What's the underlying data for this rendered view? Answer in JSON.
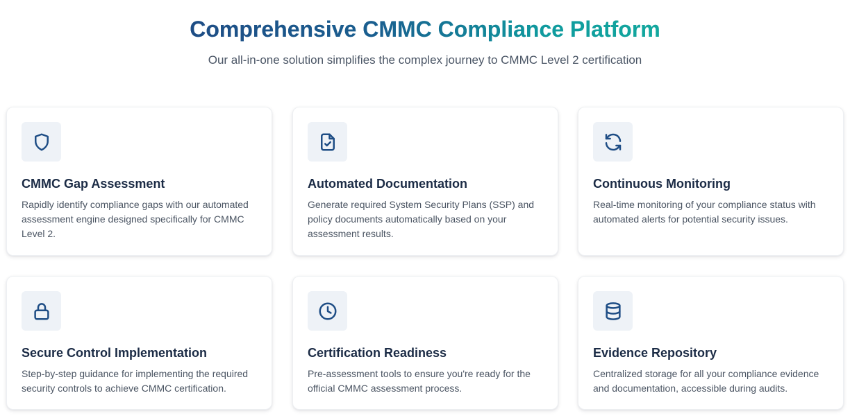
{
  "header": {
    "title": "Comprehensive CMMC Compliance Platform",
    "subtitle": "Our all-in-one solution simplifies the complex journey to CMMC Level 2 certification"
  },
  "colors": {
    "title_gradient_start": "#1e4d85",
    "title_gradient_end": "#13a89e",
    "icon_color": "#1e4d85",
    "icon_background": "#eef2f7",
    "card_title": "#1b2b45",
    "body_text": "#4b5563"
  },
  "features": [
    {
      "icon": "shield-icon",
      "title": "CMMC Gap Assessment",
      "description": "Rapidly identify compliance gaps with our automated assessment engine designed specifically for CMMC Level 2."
    },
    {
      "icon": "document-check-icon",
      "title": "Automated Documentation",
      "description": "Generate required System Security Plans (SSP) and policy documents automatically based on your assessment results."
    },
    {
      "icon": "refresh-icon",
      "title": "Continuous Monitoring",
      "description": "Real-time monitoring of your compliance status with automated alerts for potential security issues."
    },
    {
      "icon": "lock-icon",
      "title": "Secure Control Implementation",
      "description": "Step-by-step guidance for implementing the required security controls to achieve CMMC certification."
    },
    {
      "icon": "clock-icon",
      "title": "Certification Readiness",
      "description": "Pre-assessment tools to ensure you're ready for the official CMMC assessment process."
    },
    {
      "icon": "database-icon",
      "title": "Evidence Repository",
      "description": "Centralized storage for all your compliance evidence and documentation, accessible during audits."
    }
  ]
}
